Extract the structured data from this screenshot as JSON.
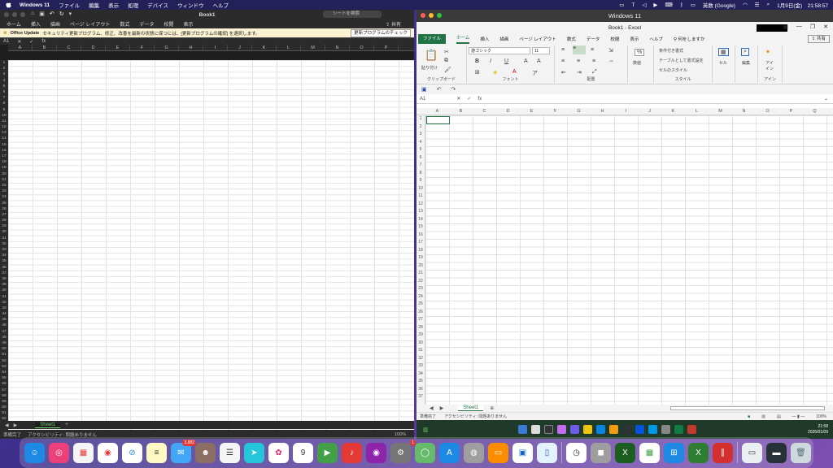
{
  "menubar": {
    "app": "Windows 11",
    "items": [
      "ファイル",
      "編集",
      "表示",
      "処理",
      "デバイス",
      "ウィンドウ",
      "ヘルプ"
    ],
    "input_method": "英数 (Google)",
    "datetime": "1月9日(金)　21:58:57"
  },
  "left_excel": {
    "title": "Book1",
    "search_placeholder": "シートを検索",
    "tabs": [
      "ホーム",
      "挿入",
      "描画",
      "ページ レイアウト",
      "数式",
      "データ",
      "校閲",
      "表示"
    ],
    "share": "共有",
    "notice_title": "Office Update",
    "notice_text": "セキュリティ更新プログラム、修正、改善を最新の状態に保つには、[更新プログラムの確認] を選択します。",
    "notice_button": "更新プログラムのチェック",
    "namebox": "A1",
    "columns": [
      "A",
      "B",
      "C",
      "D",
      "E",
      "F",
      "G",
      "H",
      "I",
      "J",
      "K",
      "L",
      "M",
      "N",
      "O",
      "P"
    ],
    "sheet_tab": "Sheet1",
    "status_ready": "準備完了",
    "status_access": "アクセシビリティ: 問題ありません",
    "zoom": "100%"
  },
  "window": {
    "title": "Windows 11"
  },
  "right_excel": {
    "title": "Book1  -  Excel",
    "tabs": [
      "ファイル",
      "ホーム",
      "挿入",
      "描画",
      "ページ レイアウト",
      "数式",
      "データ",
      "校閲",
      "表示",
      "ヘルプ"
    ],
    "tell_me": "何をしますか",
    "share": "共有",
    "font_name": "游ゴシック",
    "font_size": "11",
    "groups": [
      "クリップボード",
      "フォント",
      "配置",
      "スタイル",
      "アイン"
    ],
    "paste_label": "貼り付け",
    "number_label": "数値",
    "cond_format": "条件付き書式",
    "table_format": "テーブルとして書式設定",
    "cell_styles": "セルのスタイル",
    "cells_label": "セル",
    "edit_label": "編集",
    "idea_label": "アイ\nイン",
    "namebox": "A1",
    "fx": "fx",
    "columns": [
      "A",
      "B",
      "C",
      "D",
      "E",
      "F",
      "G",
      "H",
      "I",
      "J",
      "K",
      "L",
      "M",
      "N",
      "O",
      "P",
      "Q"
    ],
    "sheet_tab": "Sheet1",
    "status_ready": "準備完了",
    "status_access": "アクセシビリティ: 問題ありません",
    "zoom": "100%"
  },
  "taskbar": {
    "time": "21:58",
    "date": "2026/01/09"
  },
  "dock": {
    "mail_badge": "3,882",
    "settings_badge": "1"
  }
}
